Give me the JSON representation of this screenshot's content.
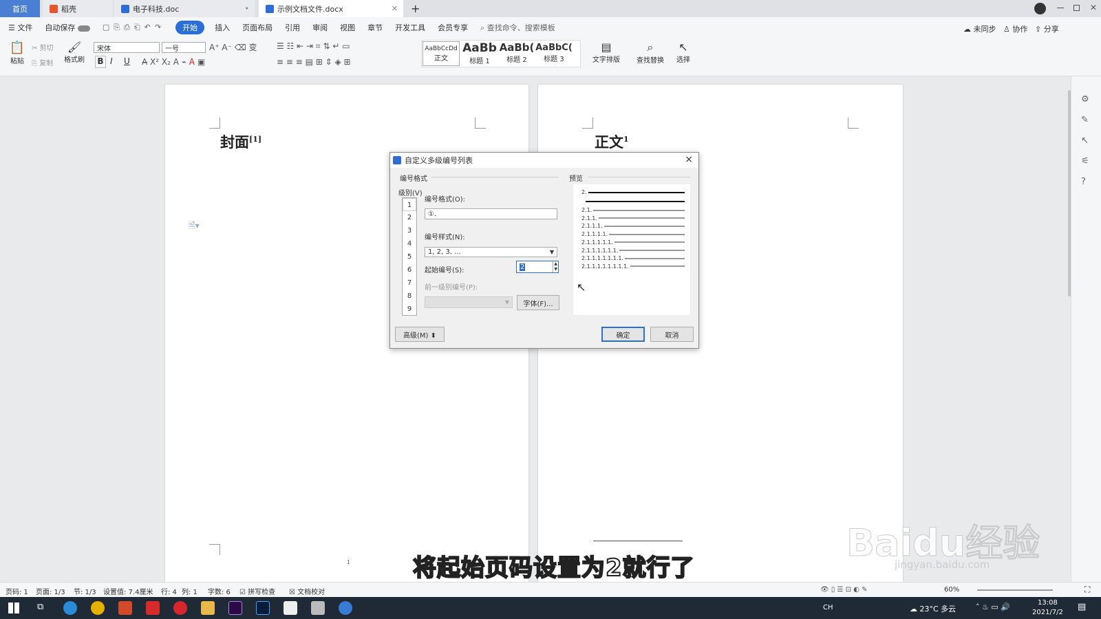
{
  "tabs": {
    "home": "首页",
    "daoke": "稻壳",
    "doc1": "电子科技.doc",
    "doc2": "示例文档文件.docx",
    "new_tab": "+"
  },
  "menubar": {
    "file": "文件",
    "autosave": "自动保存",
    "start": "开始",
    "insert": "插入",
    "layout": "页面布局",
    "ref": "引用",
    "review": "审阅",
    "view": "视图",
    "chapter": "章节",
    "devtools": "开发工具",
    "member": "会员专享",
    "search": "查找命令、搜索模板",
    "unsync": "未同步",
    "collab": "协作",
    "share": "分享"
  },
  "ribbon": {
    "paste": "粘贴",
    "cut": "剪切",
    "copy": "复制",
    "format_painter": "格式刷",
    "font": "宋体",
    "size": "一号",
    "styles": [
      {
        "sample": "AaBbCcDd",
        "label": "正文"
      },
      {
        "sample": "AaBb",
        "label": "标题 1"
      },
      {
        "sample": "AaBb(",
        "label": "标题 2"
      },
      {
        "sample": "AaBbC(",
        "label": "标题 3"
      }
    ],
    "text_layout": "文字排版",
    "find_replace": "查找替换",
    "select": "选择",
    "bold": "B",
    "italic": "I",
    "underline": "U"
  },
  "pages": {
    "left_heading": "封面",
    "left_sup": "[1]",
    "right_heading": "正文",
    "right_sup": "1",
    "footer_num": "1"
  },
  "dialog": {
    "title": "自定义多级编号列表",
    "close": "×",
    "section_format": "编号格式",
    "section_preview": "预览",
    "level_label": "级别(V)",
    "levels": [
      "1",
      "2",
      "3",
      "4",
      "5",
      "6",
      "7",
      "8",
      "9"
    ],
    "number_format_label": "编号格式(O):",
    "number_format_value": "①.",
    "number_style_label": "编号样式(N):",
    "number_style_value": "1, 2, 3, ...",
    "start_label": "起始编号(S):",
    "start_value": "2",
    "prev_level_label": "前一级别编号(P):",
    "font_btn": "字体(F)...",
    "advanced_btn": "高级(M) ⬍",
    "ok_btn": "确定",
    "cancel_btn": "取消",
    "preview_items": [
      "2.",
      "2.1.",
      "2.1.1.",
      "2.1.1.1.",
      "2.1.1.1.1.",
      "2.1.1.1.1.1.",
      "2.1.1.1.1.1.1.",
      "2.1.1.1.1.1.1.1.",
      "2.1.1.1.1.1.1.1.1."
    ]
  },
  "status": {
    "page": "页码: 1",
    "pages": "页面: 1/3",
    "section": "节: 1/3",
    "setting": "设置值: 7.4厘米",
    "row": "行: 4",
    "col": "列: 1",
    "words": "字数: 6",
    "spell": "拼写检查",
    "doc_check": "文档校对",
    "zoom": "60%"
  },
  "taskbar": {
    "weather": "23°C 多云",
    "time": "13:08",
    "date": "2021/7/2",
    "ime": "CH"
  },
  "overlay": {
    "subtitle": "将起始页码设置为2就行了",
    "watermark": "Baidu经验",
    "watermark_url": "jingyan.baidu.com"
  }
}
